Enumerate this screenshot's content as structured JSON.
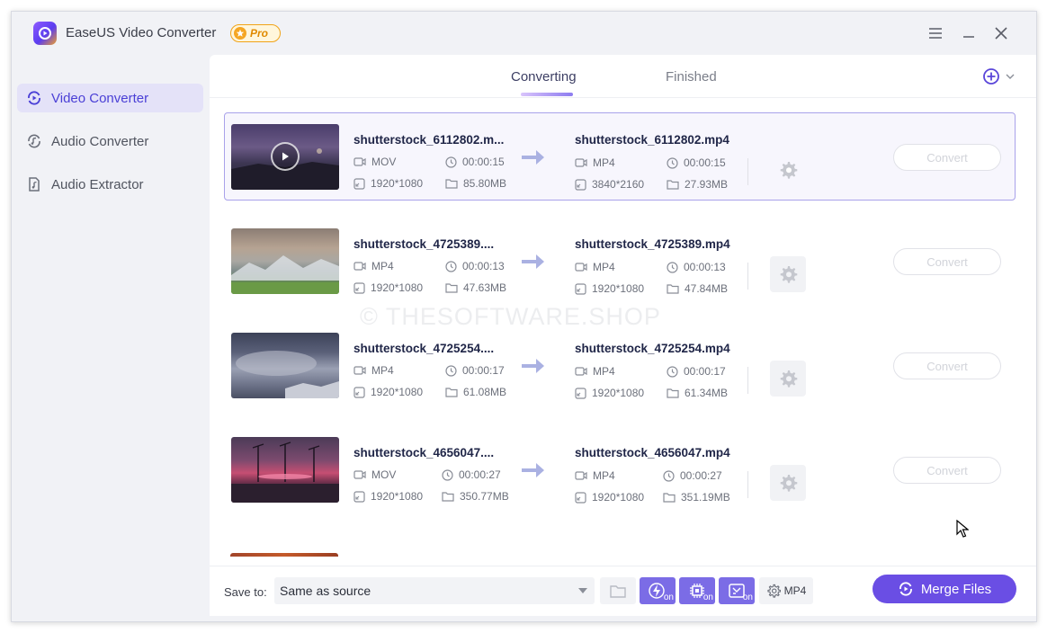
{
  "app": {
    "title": "EaseUS Video Converter",
    "badge": "Pro"
  },
  "sidebar": {
    "items": [
      {
        "label": "Video Converter",
        "icon": "video-converter-icon",
        "active": true
      },
      {
        "label": "Audio Converter",
        "icon": "audio-converter-icon",
        "active": false
      },
      {
        "label": "Audio Extractor",
        "icon": "audio-extractor-icon",
        "active": false
      }
    ]
  },
  "tabs": {
    "converting": "Converting",
    "finished": "Finished"
  },
  "rows": [
    {
      "source": {
        "name": "shutterstock_6112802.m...",
        "format": "MOV",
        "duration": "00:00:15",
        "resolution": "1920*1080",
        "size": "85.80MB"
      },
      "output": {
        "name": "shutterstock_6112802.mp4",
        "format": "MP4",
        "duration": "00:00:15",
        "resolution": "3840*2160",
        "size": "27.93MB"
      },
      "convert_label": "Convert",
      "selected": true
    },
    {
      "source": {
        "name": "shutterstock_4725389....",
        "format": "MP4",
        "duration": "00:00:13",
        "resolution": "1920*1080",
        "size": "47.63MB"
      },
      "output": {
        "name": "shutterstock_4725389.mp4",
        "format": "MP4",
        "duration": "00:00:13",
        "resolution": "1920*1080",
        "size": "47.84MB"
      },
      "convert_label": "Convert",
      "selected": false
    },
    {
      "source": {
        "name": "shutterstock_4725254....",
        "format": "MP4",
        "duration": "00:00:17",
        "resolution": "1920*1080",
        "size": "61.08MB"
      },
      "output": {
        "name": "shutterstock_4725254.mp4",
        "format": "MP4",
        "duration": "00:00:17",
        "resolution": "1920*1080",
        "size": "61.34MB"
      },
      "convert_label": "Convert",
      "selected": false
    },
    {
      "source": {
        "name": "shutterstock_4656047....",
        "format": "MOV",
        "duration": "00:00:27",
        "resolution": "1920*1080",
        "size": "350.77MB"
      },
      "output": {
        "name": "shutterstock_4656047.mp4",
        "format": "MP4",
        "duration": "00:00:27",
        "resolution": "1920*1080",
        "size": "351.19MB"
      },
      "convert_label": "Convert",
      "selected": false
    }
  ],
  "bottom": {
    "save_label": "Save to:",
    "save_value": "Same as source",
    "on_label": "on",
    "format_label": "MP4",
    "merge_label": "Merge Files"
  },
  "watermark": "© THESOFTWARE.SHOP",
  "colors": {
    "accent": "#6a4ee4",
    "accent_light": "#7b6ce6",
    "sidebar_active_bg": "#e4e2f8"
  }
}
